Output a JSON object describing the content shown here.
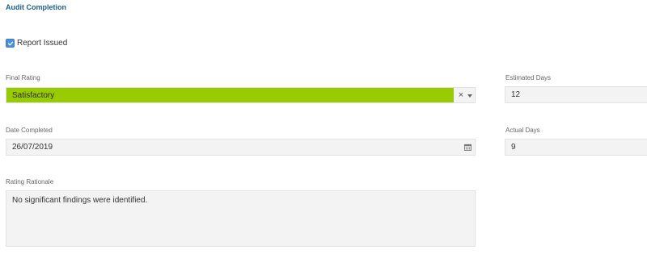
{
  "section": {
    "title": "Audit Completion"
  },
  "report_issued": {
    "label": "Report Issued",
    "checked": true
  },
  "final_rating": {
    "label": "Final Rating",
    "value": "Satisfactory",
    "value_color": "#99cc00",
    "clear_icon": "×"
  },
  "estimated_days": {
    "label": "Estimated Days",
    "value": "12"
  },
  "date_completed": {
    "label": "Date Completed",
    "value": "26/07/2019",
    "icon": "calendar-icon"
  },
  "actual_days": {
    "label": "Actual Days",
    "value": "9"
  },
  "rating_rationale": {
    "label": "Rating Rationale",
    "value": "No significant findings were identified."
  },
  "colors": {
    "accent": "#1f5f8b",
    "checkbox": "#4a90d9",
    "field_bg": "#f3f3f3"
  }
}
